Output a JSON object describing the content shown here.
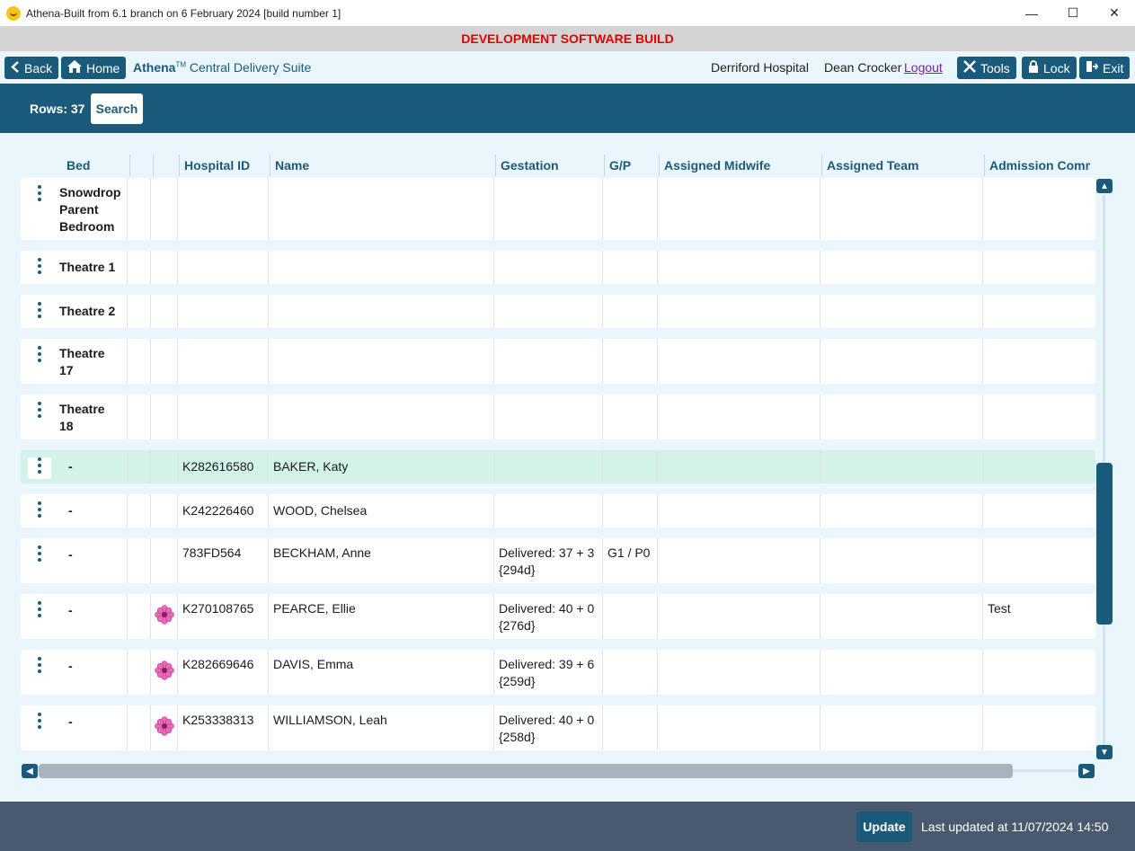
{
  "window": {
    "title": "Athena-Built from 6.1 branch on 6 February 2024 [build number 1]",
    "minimize": "—",
    "maximize": "☐",
    "close": "✕"
  },
  "banner": "DEVELOPMENT SOFTWARE BUILD",
  "nav": {
    "back_label": "Back",
    "home_label": "Home",
    "brand_name": "Athena",
    "brand_tm": "TM",
    "module": "Central Delivery Suite",
    "hospital": "Derriford Hospital",
    "user": "Dean Crocker",
    "logout": "Logout",
    "tools_label": "Tools",
    "lock_label": "Lock",
    "exit_label": "Exit"
  },
  "toolbar": {
    "rows_label": "Rows: 37",
    "search_label": "Search"
  },
  "columns": [
    "Bed",
    "",
    "",
    "Hospital ID",
    "Name",
    "Gestation",
    "G/P",
    "Assigned Midwife",
    "Assigned Team",
    "Admission Comm"
  ],
  "rows": [
    {
      "bed": "Snowdrop Parent Bedroom",
      "flower": false,
      "hospital_id": "",
      "name": "",
      "gestation": "",
      "gestation_days": "",
      "gp": "",
      "midwife": "",
      "team": "",
      "comment": "",
      "selected": false
    },
    {
      "bed": "Theatre 1",
      "flower": false,
      "hospital_id": "",
      "name": "",
      "gestation": "",
      "gestation_days": "",
      "gp": "",
      "midwife": "",
      "team": "",
      "comment": "",
      "selected": false
    },
    {
      "bed": "Theatre 2",
      "flower": false,
      "hospital_id": "",
      "name": "",
      "gestation": "",
      "gestation_days": "",
      "gp": "",
      "midwife": "",
      "team": "",
      "comment": "",
      "selected": false
    },
    {
      "bed": "Theatre 17",
      "flower": false,
      "hospital_id": "",
      "name": "",
      "gestation": "",
      "gestation_days": "",
      "gp": "",
      "midwife": "",
      "team": "",
      "comment": "",
      "selected": false
    },
    {
      "bed": "Theatre 18",
      "flower": false,
      "hospital_id": "",
      "name": "",
      "gestation": "",
      "gestation_days": "",
      "gp": "",
      "midwife": "",
      "team": "",
      "comment": "",
      "selected": false
    },
    {
      "bed": "-",
      "flower": false,
      "hospital_id": "K282616580",
      "name": "BAKER, Katy",
      "gestation": "",
      "gestation_days": "",
      "gp": "",
      "midwife": "",
      "team": "",
      "comment": "",
      "selected": true
    },
    {
      "bed": "-",
      "flower": false,
      "hospital_id": "K242226460",
      "name": "WOOD, Chelsea",
      "gestation": "",
      "gestation_days": "",
      "gp": "",
      "midwife": "",
      "team": "",
      "comment": "",
      "selected": false
    },
    {
      "bed": "-",
      "flower": false,
      "hospital_id": "783FD564",
      "name": "BECKHAM, Anne",
      "gestation": "Delivered: 37 + 3",
      "gestation_days": "{294d}",
      "gp": "G1 / P0",
      "midwife": "",
      "team": "",
      "comment": "",
      "selected": false
    },
    {
      "bed": "-",
      "flower": true,
      "hospital_id": "K270108765",
      "name": "PEARCE, Ellie",
      "gestation": "Delivered: 40 + 0",
      "gestation_days": "{276d}",
      "gp": "",
      "midwife": "",
      "team": "",
      "comment": "Test",
      "selected": false
    },
    {
      "bed": "-",
      "flower": true,
      "hospital_id": "K282669646",
      "name": "DAVIS, Emma",
      "gestation": "Delivered: 39 + 6",
      "gestation_days": "{259d}",
      "gp": "",
      "midwife": "",
      "team": "",
      "comment": "",
      "selected": false
    },
    {
      "bed": "-",
      "flower": true,
      "hospital_id": "K253338313",
      "name": "WILLIAMSON, Leah",
      "gestation": "Delivered: 40 + 0",
      "gestation_days": "{258d}",
      "gp": "",
      "midwife": "",
      "team": "",
      "comment": "",
      "selected": false
    }
  ],
  "footer": {
    "update_label": "Update",
    "last_updated": "Last updated at 11/07/2024 14:50"
  },
  "colors": {
    "primary": "#1a5a7a",
    "banner_text": "#e00000",
    "selected_row": "#d3f2ea",
    "footer_bg": "#4a5a6e"
  },
  "icons": [
    "back-chevron-icon",
    "home-icon",
    "tools-icon",
    "lock-icon",
    "exit-icon",
    "kebab-menu-icon",
    "flower-icon"
  ]
}
